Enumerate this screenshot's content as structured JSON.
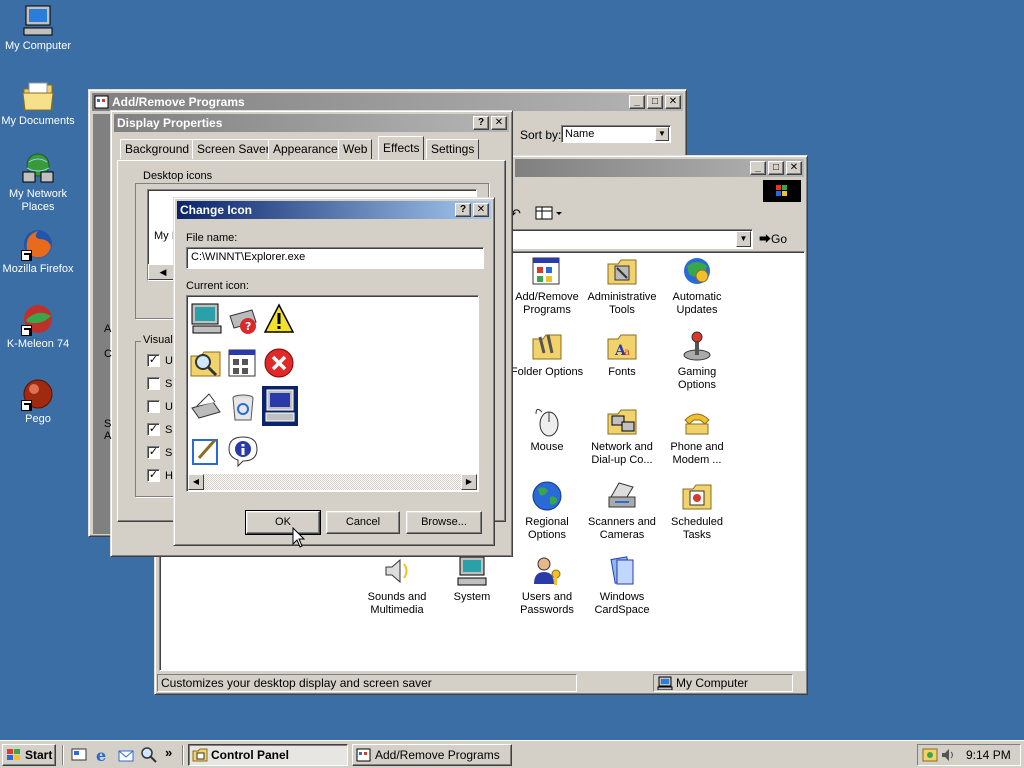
{
  "desktop": {
    "icons": [
      {
        "label": "My Computer",
        "icon": "computer-icon"
      },
      {
        "label": "My Documents",
        "icon": "folder-icon"
      },
      {
        "label": "My Network Places",
        "icon": "network-icon"
      },
      {
        "label": "Mozilla Firefox",
        "icon": "firefox-icon"
      },
      {
        "label": "K-Meleon 74",
        "icon": "kmeleon-icon"
      },
      {
        "label": "Pego",
        "icon": "pego-icon"
      }
    ]
  },
  "add_remove": {
    "title": "Add/Remove Programs",
    "sort_label": "Sort by:",
    "sort_value": "Name"
  },
  "control_panel": {
    "go_label": "Go",
    "status_left": "Customizes your desktop display and screen saver",
    "status_right": "My Computer",
    "items": [
      {
        "label": "Add/Remove Programs",
        "icon": "add-remove-programs-icon"
      },
      {
        "label": "Administrative Tools",
        "icon": "administrative-tools-icon"
      },
      {
        "label": "Automatic Updates",
        "icon": "automatic-updates-icon"
      },
      {
        "label": "Folder Options",
        "icon": "folder-options-icon"
      },
      {
        "label": "Fonts",
        "icon": "fonts-icon"
      },
      {
        "label": "Gaming Options",
        "icon": "gaming-options-icon"
      },
      {
        "label": "Mouse",
        "icon": "mouse-icon"
      },
      {
        "label": "Network and Dial-up Co...",
        "icon": "network-dialup-icon"
      },
      {
        "label": "Phone and Modem ...",
        "icon": "phone-modem-icon"
      },
      {
        "label": "Regional Options",
        "icon": "regional-options-icon"
      },
      {
        "label": "Scanners and Cameras",
        "icon": "scanners-cameras-icon"
      },
      {
        "label": "Scheduled Tasks",
        "icon": "scheduled-tasks-icon"
      },
      {
        "label": "Sounds and Multimedia",
        "icon": "sounds-multimedia-icon"
      },
      {
        "label": "System",
        "icon": "system-icon"
      },
      {
        "label": "Users and Passwords",
        "icon": "users-passwords-icon"
      },
      {
        "label": "Windows CardSpace",
        "icon": "cardspace-icon"
      }
    ]
  },
  "display_properties": {
    "title": "Display Properties",
    "tabs": [
      "Background",
      "Screen Saver",
      "Appearance",
      "Web",
      "Effects",
      "Settings"
    ],
    "selected_tab": "Effects",
    "desktop_icons_label": "Desktop icons",
    "visual_label": "Visual",
    "partial_desktop_label": "My I",
    "checkbox_fragments": [
      "U",
      "Sr",
      "U",
      "Sh",
      "Sh",
      "H"
    ],
    "checkbox_states": [
      true,
      false,
      false,
      true,
      true,
      true
    ],
    "left_fragments": [
      "A",
      "C",
      "S",
      "A"
    ]
  },
  "change_icon": {
    "title": "Change Icon",
    "file_label": "File name:",
    "file_value": "C:\\WINNT\\Explorer.exe",
    "current_label": "Current icon:",
    "icons": [
      "monitor-icon",
      "printer-help-icon",
      "warning-icon",
      "search-folder-icon",
      "program-grid-icon",
      "error-icon",
      "printer-icon",
      "recycle-bin-icon",
      "computer-selected-icon",
      "notepad-icon",
      "info-icon"
    ],
    "ok_label": "OK",
    "cancel_label": "Cancel",
    "browse_label": "Browse..."
  },
  "taskbar": {
    "start_label": "Start",
    "tasks": [
      {
        "label": "Control Panel",
        "pressed": true
      },
      {
        "label": "Add/Remove Programs",
        "pressed": false
      }
    ],
    "chevron": "»",
    "clock": "9:14 PM"
  },
  "colors": {
    "desktop": "#3a6ea5",
    "title_active": "#0a246a",
    "title_inactive": "#808080",
    "face": "#d4d0c8"
  }
}
